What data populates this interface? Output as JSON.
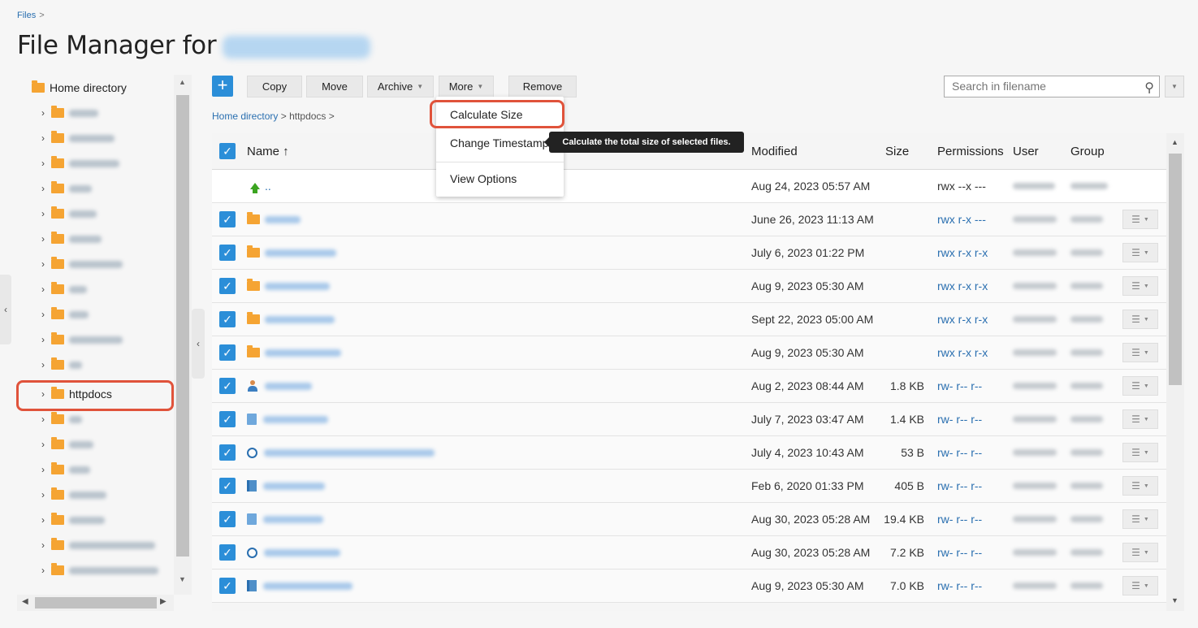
{
  "breadcrumb_top": {
    "files": "Files",
    "sep": ">"
  },
  "page_title": "File Manager for",
  "tree": {
    "root_label": "Home directory",
    "highlighted_item": "httpdocs"
  },
  "toolbar": {
    "add_label": "+",
    "copy": "Copy",
    "move": "Move",
    "archive": "Archive",
    "more": "More",
    "remove": "Remove",
    "search_placeholder": "Search in filename"
  },
  "breadcrumb": {
    "home": "Home directory",
    "sep": ">",
    "current": "httpdocs"
  },
  "more_menu": {
    "calculate_size": "Calculate Size",
    "change_timestamp": "Change Timestamp",
    "view_options": "View Options"
  },
  "tooltip": "Calculate the total size of selected files.",
  "table": {
    "headers": {
      "name": "Name ↑",
      "modified": "Modified",
      "size": "Size",
      "permissions": "Permissions",
      "user": "User",
      "group": "Group"
    },
    "parent": {
      "name": "..",
      "modified": "Aug 24, 2023 05:57 AM",
      "permissions": "rwx --x ---"
    },
    "rows": [
      {
        "modified": "June 26, 2023 11:13 AM",
        "size": "",
        "permissions": "rwx r-x ---"
      },
      {
        "modified": "July 6, 2023 01:22 PM",
        "size": "",
        "permissions": "rwx r-x r-x"
      },
      {
        "modified": "Aug 9, 2023 05:30 AM",
        "size": "",
        "permissions": "rwx r-x r-x"
      },
      {
        "modified": "Sept 22, 2023 05:00 AM",
        "size": "",
        "permissions": "rwx r-x r-x"
      },
      {
        "modified": "Aug 9, 2023 05:30 AM",
        "size": "",
        "permissions": "rwx r-x r-x"
      },
      {
        "modified": "Aug 2, 2023 08:44 AM",
        "size": "1.8 KB",
        "permissions": "rw- r-- r--"
      },
      {
        "modified": "July 7, 2023 03:47 AM",
        "size": "1.4 KB",
        "permissions": "rw- r-- r--"
      },
      {
        "modified": "July 4, 2023 10:43 AM",
        "size": "53 B",
        "permissions": "rw- r-- r--"
      },
      {
        "modified": "Feb 6, 2020 01:33 PM",
        "size": "405 B",
        "permissions": "rw- r-- r--"
      },
      {
        "modified": "Aug 30, 2023 05:28 AM",
        "size": "19.4 KB",
        "permissions": "rw- r-- r--"
      },
      {
        "modified": "Aug 30, 2023 05:28 AM",
        "size": "7.2 KB",
        "permissions": "rw- r-- r--"
      },
      {
        "modified": "Aug 9, 2023 05:30 AM",
        "size": "7.0 KB",
        "permissions": "rw- r-- r--"
      }
    ]
  },
  "colors": {
    "accent": "#2b8ed8",
    "highlight": "#e0533b",
    "folder": "#f5a433",
    "link": "#2a6fb0"
  },
  "icons": {
    "folder": "folder-icon",
    "up": "parent-directory-icon",
    "search": "search-icon",
    "row_menu": "row-menu-icon"
  }
}
